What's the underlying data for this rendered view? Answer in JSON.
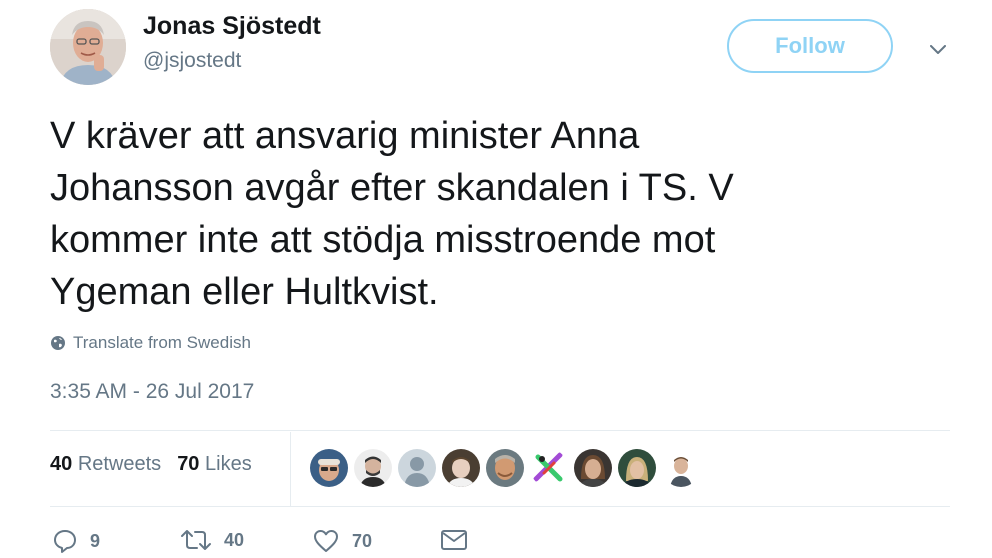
{
  "user": {
    "name": "Jonas Sjöstedt",
    "handle": "@jsjostedt"
  },
  "header": {
    "follow_label": "Follow",
    "caret_icon": "chevron-down-icon"
  },
  "tweet": {
    "lines": [
      "V kräver att ansvarig minister Anna",
      "Johansson avgår efter skandalen i TS. V",
      "kommer inte att stödja misstroende mot",
      "Ygeman eller Hultkvist."
    ],
    "translate_label": "Translate from Swedish",
    "translate_icon": "globe-icon",
    "timestamp": "3:35 AM - 26 Jul 2017"
  },
  "stats": {
    "retweets_count": "40",
    "retweets_label": "Retweets",
    "likes_count": "70",
    "likes_label": "Likes"
  },
  "likers": [
    {
      "icon": "avatar-1",
      "bg": "#3b5f86"
    },
    {
      "icon": "avatar-2",
      "bg": "#e8e8e8"
    },
    {
      "icon": "avatar-3",
      "bg": "#ccd6dd"
    },
    {
      "icon": "avatar-4",
      "bg": "#5a4a3a"
    },
    {
      "icon": "avatar-5",
      "bg": "#b8865c"
    },
    {
      "icon": "avatar-6",
      "bg": "#ffffff"
    },
    {
      "icon": "avatar-7",
      "bg": "#3a3a3a"
    },
    {
      "icon": "avatar-8",
      "bg": "#2b4a3a"
    },
    {
      "icon": "avatar-9",
      "bg": "#ffffff"
    }
  ],
  "actions": {
    "reply_count": "9",
    "retweet_count": "40",
    "like_count": "70"
  },
  "colors": {
    "text": "#14171a",
    "secondary": "#657786",
    "follow_border": "#8fd3f5",
    "divider": "#e6ecf0",
    "accent": "#1da1f2"
  }
}
